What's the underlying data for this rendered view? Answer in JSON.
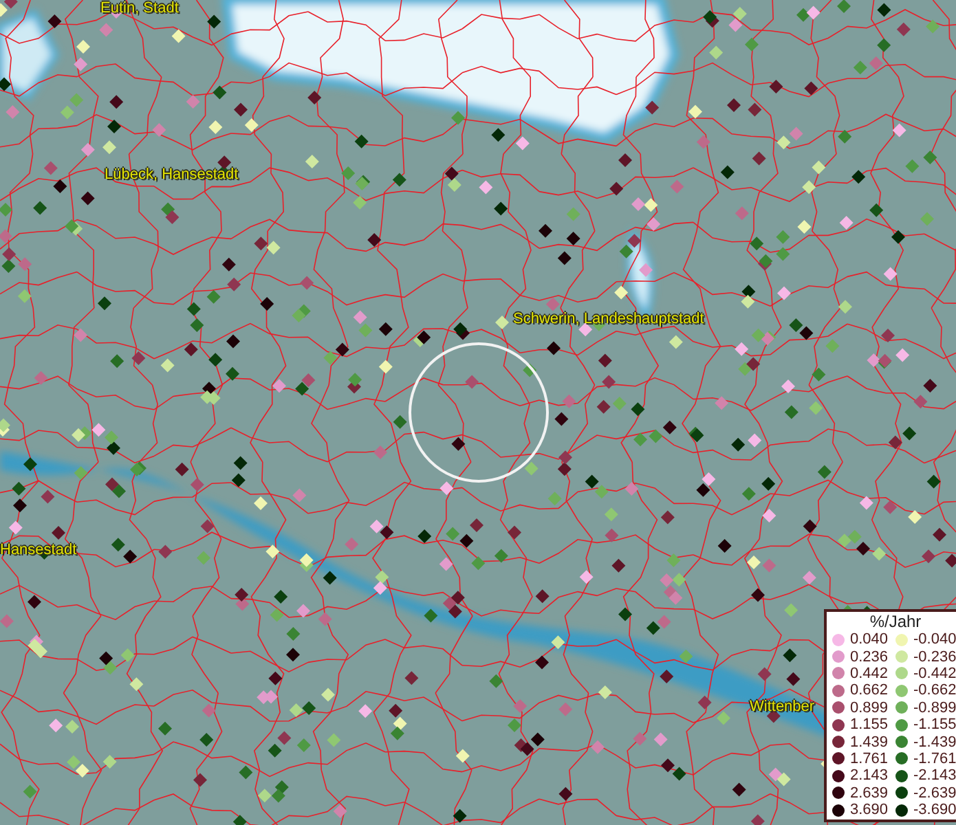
{
  "map": {
    "place_labels": [
      "Eutin, Stadt",
      "Lübeck, Hansestadt",
      "Schwerin, Landeshauptstadt",
      "Hansestadt",
      "Wittenber"
    ]
  },
  "legend": {
    "title": "%/Jahr",
    "rows": [
      [
        {
          "value": "0.040",
          "color": "#f6b8e6"
        },
        {
          "value": "-0.040",
          "color": "#f0f5b0"
        }
      ],
      [
        {
          "value": "0.236",
          "color": "#e29bcb"
        },
        {
          "value": "-0.236",
          "color": "#cfe8a0"
        }
      ],
      [
        {
          "value": "0.442",
          "color": "#d184ab"
        },
        {
          "value": "-0.442",
          "color": "#aed88a"
        }
      ],
      [
        {
          "value": "0.662",
          "color": "#bd6a8a"
        },
        {
          "value": "-0.662",
          "color": "#8fc772"
        }
      ],
      [
        {
          "value": "0.899",
          "color": "#a94f6d"
        },
        {
          "value": "-0.899",
          "color": "#6fb05a"
        }
      ],
      [
        {
          "value": "1.155",
          "color": "#8f3651"
        },
        {
          "value": "-1.155",
          "color": "#4f9a44"
        }
      ],
      [
        {
          "value": "1.439",
          "color": "#772639"
        },
        {
          "value": "-1.439",
          "color": "#3a8433"
        }
      ],
      [
        {
          "value": "1.761",
          "color": "#5e1527"
        },
        {
          "value": "-1.761",
          "color": "#276d25"
        }
      ],
      [
        {
          "value": "2.143",
          "color": "#45091a"
        },
        {
          "value": "-2.143",
          "color": "#165418"
        }
      ],
      [
        {
          "value": "2.639",
          "color": "#30040f"
        },
        {
          "value": "-2.639",
          "color": "#0b400f"
        }
      ],
      [
        {
          "value": "3.690",
          "color": "#1c0207"
        },
        {
          "value": "-3.690",
          "color": "#042807"
        }
      ]
    ]
  }
}
